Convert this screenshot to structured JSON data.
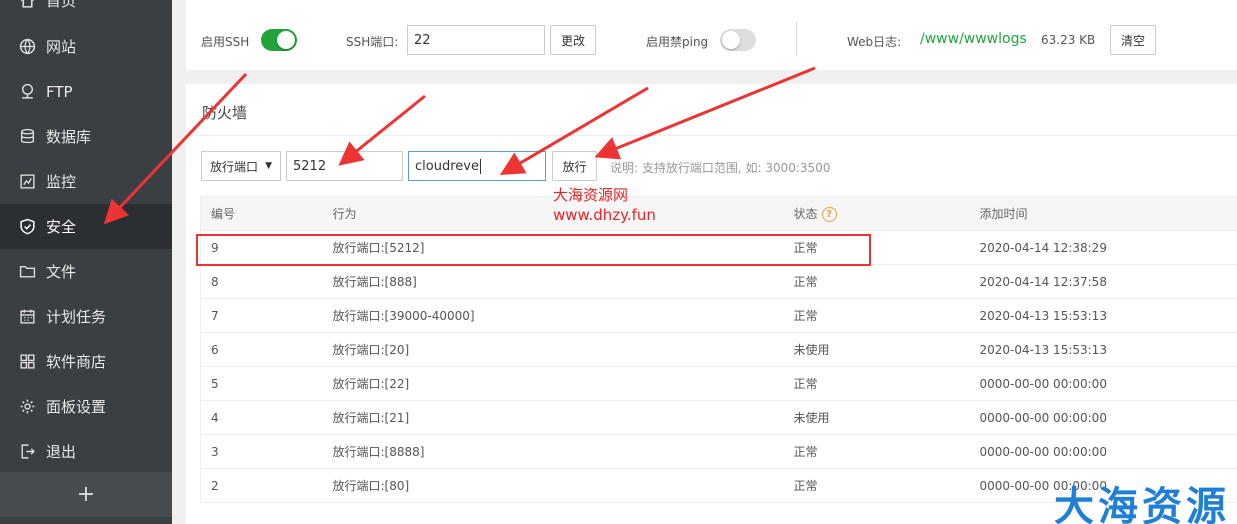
{
  "sidebar": {
    "items": [
      {
        "label": "首页",
        "icon": "home-icon"
      },
      {
        "label": "网站",
        "icon": "globe-icon"
      },
      {
        "label": "FTP",
        "icon": "ftp-icon"
      },
      {
        "label": "数据库",
        "icon": "database-icon"
      },
      {
        "label": "监控",
        "icon": "monitor-icon"
      },
      {
        "label": "安全",
        "icon": "shield-icon",
        "active": true
      },
      {
        "label": "文件",
        "icon": "folder-icon"
      },
      {
        "label": "计划任务",
        "icon": "calendar-icon"
      },
      {
        "label": "软件商店",
        "icon": "apps-icon"
      },
      {
        "label": "面板设置",
        "icon": "gear-icon"
      },
      {
        "label": "退出",
        "icon": "logout-icon"
      }
    ],
    "add_label": "+"
  },
  "top": {
    "ssh_label": "启用SSH",
    "ssh_enabled": true,
    "ssh_port_label": "SSH端口:",
    "ssh_port_value": "22",
    "change_label": "更改",
    "ping_label": "启用禁ping",
    "ping_enabled": false,
    "weblog_label": "Web日志:",
    "weblog_path": "/www/wwwlogs",
    "weblog_size": "63.23 KB",
    "clear_label": "清空"
  },
  "firewall": {
    "title": "防火墙",
    "select_value": "放行端口",
    "port_value": "5212",
    "remark_value": "cloudreve",
    "submit_label": "放行",
    "hint": "说明: 支持放行端口范围, 如: 3000:3500",
    "columns": [
      "编号",
      "行为",
      "状态",
      "添加时间"
    ],
    "rows": [
      {
        "id": "9",
        "action": "放行端口:[5212]",
        "status": "正常",
        "time": "2020-04-14 12:38:29"
      },
      {
        "id": "8",
        "action": "放行端口:[888]",
        "status": "正常",
        "time": "2020-04-14 12:37:58"
      },
      {
        "id": "7",
        "action": "放行端口:[39000-40000]",
        "status": "正常",
        "time": "2020-04-13 15:53:13"
      },
      {
        "id": "6",
        "action": "放行端口:[20]",
        "status": "未使用",
        "time": "2020-04-13 15:53:13"
      },
      {
        "id": "5",
        "action": "放行端口:[22]",
        "status": "正常",
        "time": "0000-00-00 00:00:00"
      },
      {
        "id": "4",
        "action": "放行端口:[21]",
        "status": "未使用",
        "time": "0000-00-00 00:00:00"
      },
      {
        "id": "3",
        "action": "放行端口:[8888]",
        "status": "正常",
        "time": "0000-00-00 00:00:00"
      },
      {
        "id": "2",
        "action": "放行端口:[80]",
        "status": "正常",
        "time": "0000-00-00 00:00:00"
      }
    ]
  },
  "watermark": {
    "line1": "大海资源网",
    "line2": "www.dhzy.fun",
    "big": "大海资源"
  },
  "colors": {
    "sidebar_bg": "#3a3f44",
    "accent_green": "#20a53a",
    "annotation_red": "#e33333",
    "watermark_blue": "#1f7fd6"
  }
}
